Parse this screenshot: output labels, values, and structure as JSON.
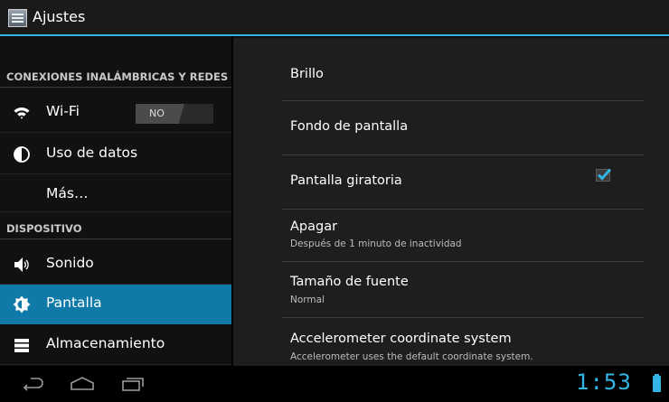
{
  "app": {
    "title": "Ajustes",
    "icon": "settings-icon"
  },
  "sidebar": {
    "categories": [
      {
        "label": "CONEXIONES INALÁMBRICAS Y REDES"
      },
      {
        "label": "DISPOSITIVO"
      }
    ],
    "items": [
      {
        "label": "Wi-Fi",
        "icon": "wifi-icon",
        "toggle": "NO"
      },
      {
        "label": "Uso de datos",
        "icon": "data-usage-icon"
      },
      {
        "label": "Más…"
      },
      {
        "label": "Sonido",
        "icon": "speaker-icon"
      },
      {
        "label": "Pantalla",
        "icon": "brightness-icon",
        "selected": true
      },
      {
        "label": "Almacenamiento",
        "icon": "storage-icon"
      }
    ]
  },
  "settings": [
    {
      "title": "Brillo",
      "summary": ""
    },
    {
      "title": "Fondo de pantalla",
      "summary": ""
    },
    {
      "title": "Pantalla giratoria",
      "summary": "",
      "checked": true
    },
    {
      "title": "Apagar",
      "summary": "Después de 1 minuto de inactividad"
    },
    {
      "title": "Tamaño de fuente",
      "summary": "Normal"
    },
    {
      "title": "Accelerometer coordinate system",
      "summary": "Accelerometer uses the default coordinate system."
    }
  ],
  "status_bar": {
    "time": "1:53",
    "battery_icon": "battery-icon"
  },
  "colors": {
    "accent": "#33b5e5",
    "selected": "#0f79a8",
    "checkmark": "#33b5e5"
  }
}
